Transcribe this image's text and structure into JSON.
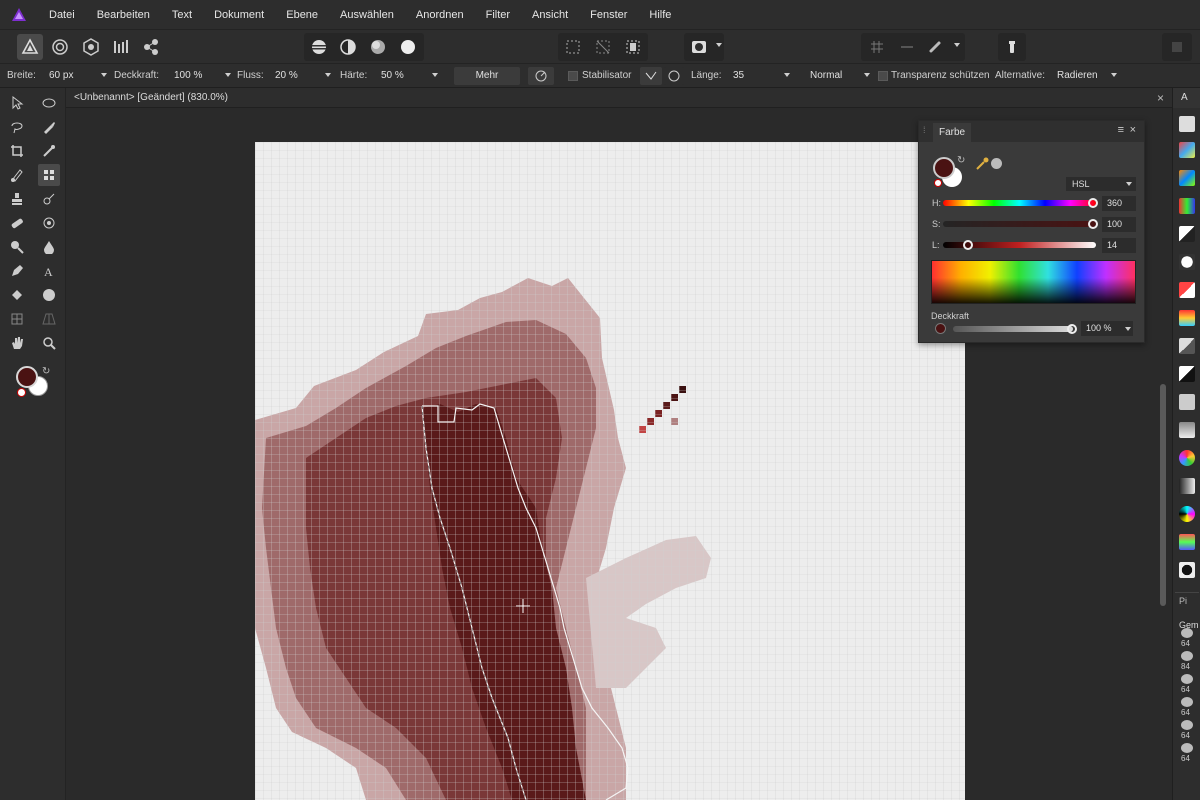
{
  "menu": {
    "items": [
      "Datei",
      "Bearbeiten",
      "Text",
      "Dokument",
      "Ebene",
      "Auswählen",
      "Anordnen",
      "Filter",
      "Ansicht",
      "Fenster",
      "Hilfe"
    ]
  },
  "context_toolbar": {
    "width_label": "Breite:",
    "width_value": "60 px",
    "opacity_label": "Deckkraft:",
    "opacity_value": "100 %",
    "flow_label": "Fluss:",
    "flow_value": "20 %",
    "hardness_label": "Härte:",
    "hardness_value": "50 %",
    "more_label": "Mehr",
    "stabilizer_label": "Stabilisator",
    "length_label": "Länge:",
    "length_value": "35",
    "blend_mode": "Normal",
    "protect_alpha_label": "Transparenz schützen",
    "alternative_label": "Alternative:",
    "alternative_value": "Radieren"
  },
  "document": {
    "title": "<Unbenannt> [Geändert] (830.0%)",
    "close_glyph": "×"
  },
  "color_panel": {
    "tab_label": "Farbe",
    "model": "HSL",
    "h_label": "H:",
    "h_value": "360",
    "s_label": "S:",
    "s_value": "100",
    "l_label": "L:",
    "l_value": "14",
    "opacity_label": "Deckkraft",
    "opacity_value": "100 %",
    "menu_glyph": "≡",
    "close_glyph": "×",
    "primary_color": "#4a1212",
    "secondary_color": "#ffffff"
  },
  "right_strip": {
    "top_label": "A",
    "pi_label": "Pi",
    "gem_label": "Gem",
    "brush_sizes": [
      "64",
      "84",
      "64",
      "64",
      "64",
      "64"
    ]
  },
  "colors": {
    "accent": "#7e2fd0",
    "paint_dark": "#5a1a1a",
    "paint_light": "#c8a7a7",
    "canvas": "#ededed",
    "grid": "#cfcfcf",
    "toolbar_bg": "#2d2d2d"
  }
}
